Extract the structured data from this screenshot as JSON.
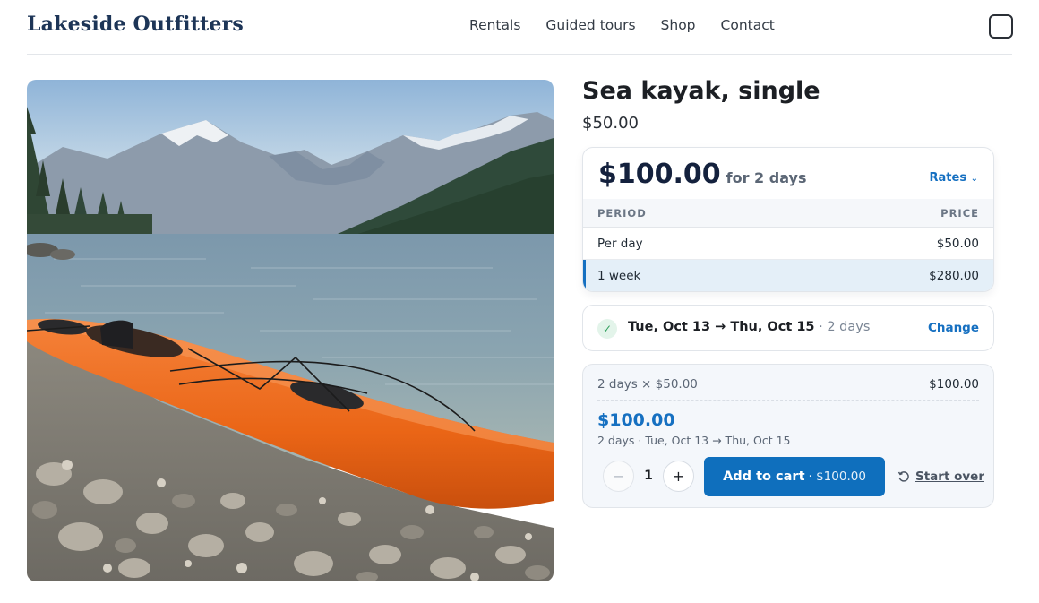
{
  "header": {
    "brand": "Lakeside Outfitters",
    "nav": [
      "Rentals",
      "Guided tours",
      "Shop",
      "Contact"
    ]
  },
  "product": {
    "title": "Sea kayak, single",
    "base_price": "$50.00"
  },
  "rates": {
    "total": "$100.00",
    "for_text": "for 2 days",
    "toggle_label": "Rates",
    "columns": [
      "PERIOD",
      "PRICE"
    ],
    "rows": [
      {
        "period": "Per day",
        "price": "$50.00",
        "selected": false
      },
      {
        "period": "1 week",
        "price": "$280.00",
        "selected": true
      }
    ]
  },
  "dates": {
    "range": "Tue, Oct 13 → Thu, Oct 15",
    "separator": " · ",
    "days": "2 days",
    "change_label": "Change"
  },
  "summary": {
    "calc_label": "2 days × $50.00",
    "calc_amount": "$100.00",
    "total": "$100.00",
    "subtext": "2 days · Tue, Oct 13 → Thu, Oct 15",
    "quantity": "1",
    "minus": "−",
    "plus": "+",
    "add_label": "Add to cart",
    "add_price": "· $100.00",
    "start_over": "Start over"
  },
  "icons": {
    "check": "✓",
    "chevron": "⌄"
  },
  "colors": {
    "accent": "#1670c1",
    "brand": "#1d3557",
    "kayak": "#ee6c1e"
  }
}
